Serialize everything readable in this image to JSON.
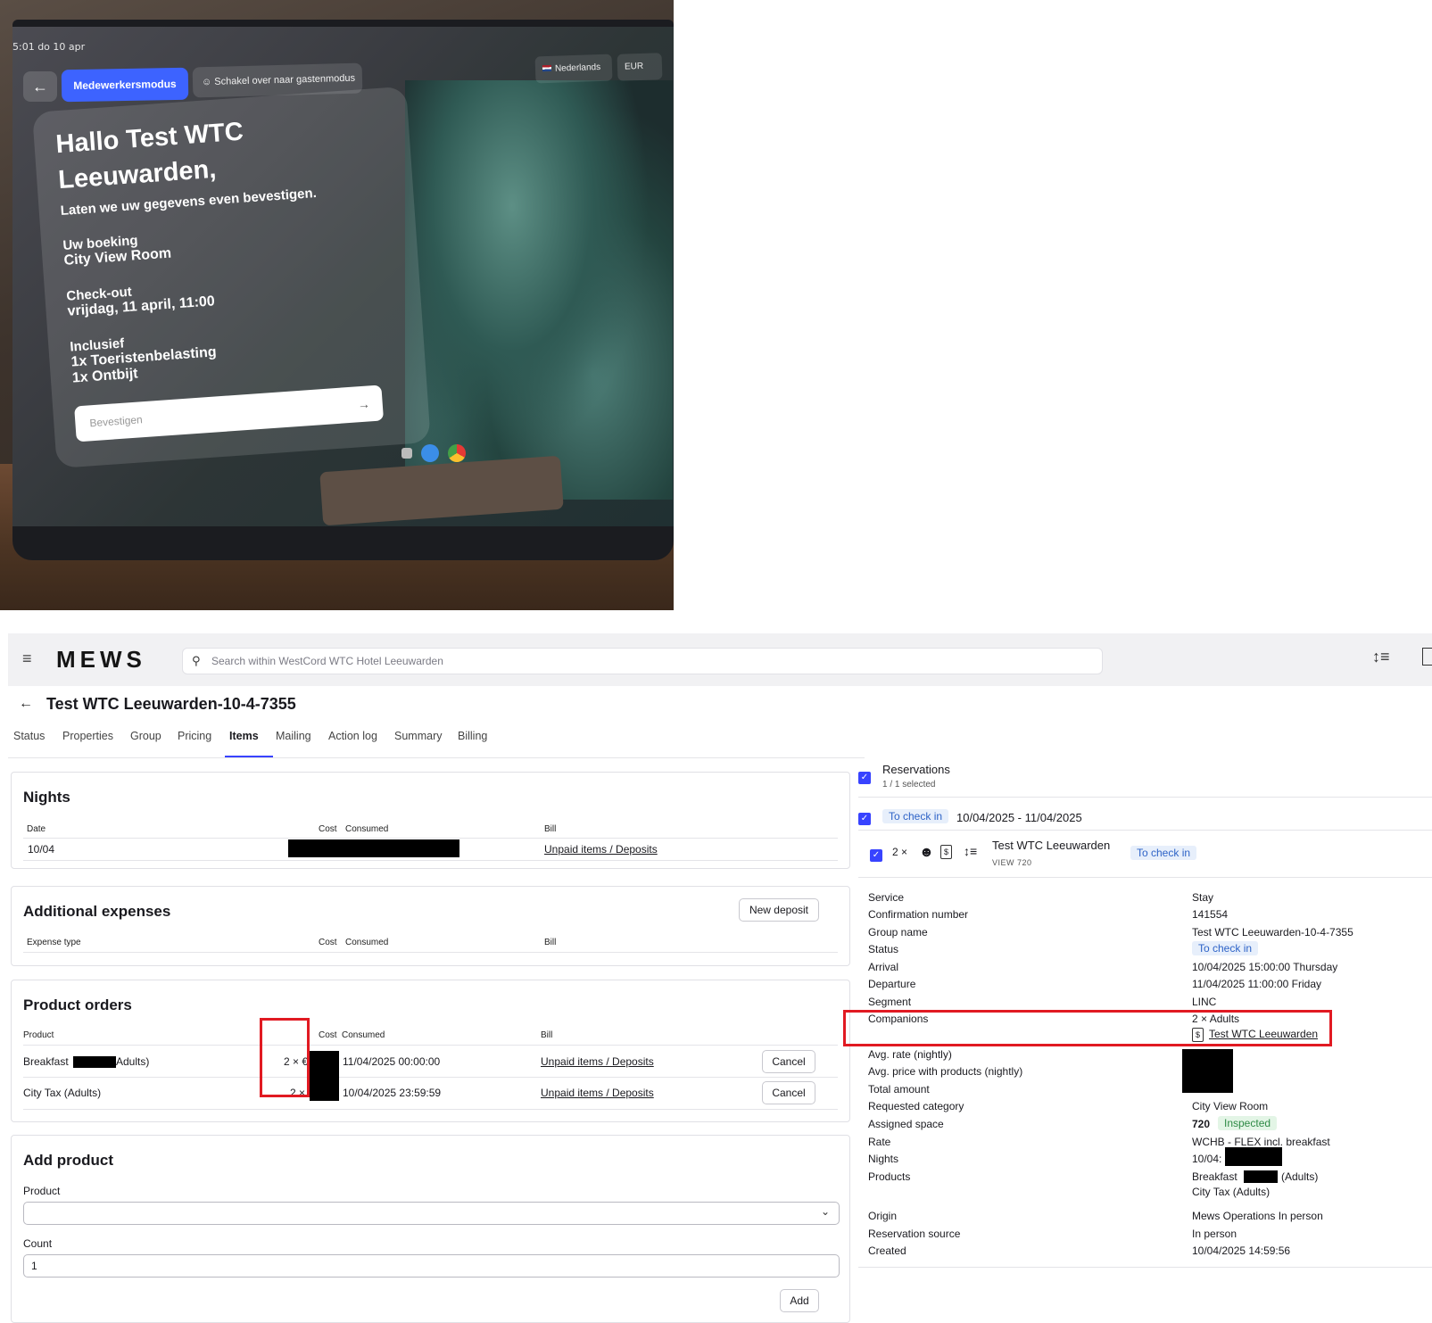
{
  "tablet": {
    "status_time": "5:01  do 10 apr",
    "staff_mode": "Medewerkersmodus",
    "guest_mode": "Schakel over naar gastenmodus",
    "language": "Nederlands",
    "currency": "EUR",
    "greeting": "Hallo Test WTC Leeuwarden,",
    "subtitle": "Laten we uw gegevens even bevestigen.",
    "booking_label": "Uw boeking",
    "booking_value": "City View Room",
    "checkout_label": "Check-out",
    "checkout_value": "vrijdag, 11 april, 11:00",
    "included_label": "Inclusief",
    "included_items": [
      "1x Toeristenbelasting",
      "1x Ontbijt"
    ],
    "confirm_placeholder": "Bevestigen"
  },
  "app": {
    "logo": "MEWS",
    "search_placeholder": "Search within WestCord WTC Hotel Leeuwarden"
  },
  "page": {
    "title": "Test WTC Leeuwarden-10-4-7355",
    "tabs": [
      "Status",
      "Properties",
      "Group",
      "Pricing",
      "Items",
      "Mailing",
      "Action log",
      "Summary",
      "Billing"
    ],
    "active_tab": "Items"
  },
  "nights": {
    "title": "Nights",
    "headers": {
      "date": "Date",
      "cost": "Cost",
      "consumed": "Consumed",
      "bill": "Bill"
    },
    "rows": [
      {
        "date": "10/04",
        "bill": "Unpaid items / Deposits"
      }
    ]
  },
  "expenses": {
    "title": "Additional expenses",
    "new_deposit": "New deposit",
    "headers": {
      "type": "Expense type",
      "cost": "Cost",
      "consumed": "Consumed",
      "bill": "Bill"
    }
  },
  "product_orders": {
    "title": "Product orders",
    "headers": {
      "product": "Product",
      "cost": "Cost",
      "consumed": "Consumed",
      "bill": "Bill"
    },
    "rows": [
      {
        "product_a": "Breakfast",
        "product_b": "Adults)",
        "qty": "2 × €",
        "consumed": "11/04/2025 00:00:00",
        "bill": "Unpaid items / Deposits",
        "action": "Cancel"
      },
      {
        "product_a": "City Tax (Adults)",
        "product_b": "",
        "qty": "2 × €",
        "consumed": "10/04/2025 23:59:59",
        "bill": "Unpaid items / Deposits",
        "action": "Cancel"
      }
    ]
  },
  "add_product": {
    "title": "Add product",
    "product_label": "Product",
    "count_label": "Count",
    "count_value": "1",
    "add_button": "Add"
  },
  "reservations": {
    "title": "Reservations",
    "selected": "1 / 1 selected",
    "status_badge": "To check in",
    "date_range": "10/04/2025 - 11/04/2025",
    "count": "2 ×",
    "guest_name": "Test WTC Leeuwarden",
    "space_code": "VIEW 720",
    "guest_status": "To check in"
  },
  "details": {
    "service": {
      "label": "Service",
      "value": "Stay"
    },
    "confirmation": {
      "label": "Confirmation number",
      "value": "141554"
    },
    "group_name": {
      "label": "Group name",
      "value": "Test WTC Leeuwarden-10-4-7355"
    },
    "status": {
      "label": "Status",
      "value": "To check in"
    },
    "arrival": {
      "label": "Arrival",
      "value": "10/04/2025 15:00:00 Thursday"
    },
    "departure": {
      "label": "Departure",
      "value": "11/04/2025 11:00:00 Friday"
    },
    "segment": {
      "label": "Segment",
      "value": "LINC"
    },
    "companions": {
      "label": "Companions",
      "value": "2 × Adults",
      "link": "Test WTC Leeuwarden"
    },
    "avg_rate": {
      "label": "Avg. rate (nightly)"
    },
    "avg_price": {
      "label": "Avg. price with products (nightly)"
    },
    "total": {
      "label": "Total amount"
    },
    "requested_category": {
      "label": "Requested category",
      "value": "City View Room"
    },
    "assigned_space": {
      "label": "Assigned space",
      "value": "720",
      "badge": "Inspected"
    },
    "rate": {
      "label": "Rate",
      "value": "WCHB - FLEX incl. breakfast"
    },
    "nights": {
      "label": "Nights",
      "value": "10/04:"
    },
    "products": {
      "label": "Products",
      "value_a": "Breakfast",
      "value_b": "(Adults)",
      "value_c": "City Tax (Adults)"
    },
    "origin": {
      "label": "Origin",
      "value": "Mews Operations In person"
    },
    "reservation_source": {
      "label": "Reservation source",
      "value": "In person"
    },
    "created": {
      "label": "Created",
      "value": "10/04/2025 14:59:56"
    }
  },
  "colors": {
    "accent": "#3843ff",
    "highlight": "#e11a22",
    "badge_blue": "#2e63c7",
    "badge_green": "#2e8a45"
  }
}
